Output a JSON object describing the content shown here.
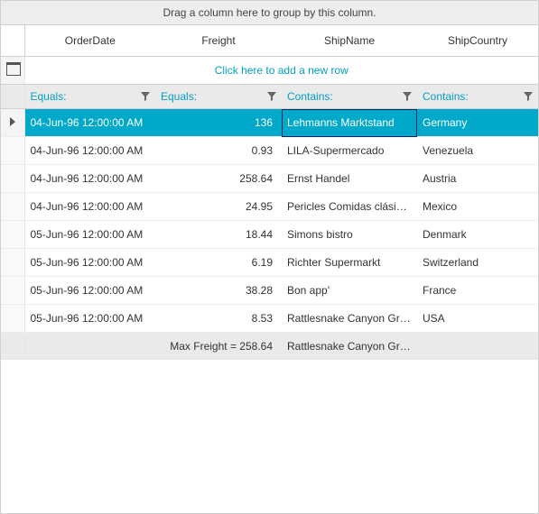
{
  "groupBar": {
    "hint": "Drag a column here to group by this column."
  },
  "columns": {
    "orderDate": "OrderDate",
    "freight": "Freight",
    "shipName": "ShipName",
    "shipCountry": "ShipCountry"
  },
  "addRow": {
    "label": "Click here to add a new row"
  },
  "filters": {
    "orderDate": "Equals:",
    "freight": "Equals:",
    "shipName": "Contains:",
    "shipCountry": "Contains:"
  },
  "rows": [
    {
      "orderDate": "04-Jun-96 12:00:00 AM",
      "freight": "136",
      "shipName": "Lehmanns Marktstand",
      "shipCountry": "Germany",
      "selected": true
    },
    {
      "orderDate": "04-Jun-96 12:00:00 AM",
      "freight": "0.93",
      "shipName": "LILA-Supermercado",
      "shipCountry": "Venezuela"
    },
    {
      "orderDate": "04-Jun-96 12:00:00 AM",
      "freight": "258.64",
      "shipName": "Ernst Handel",
      "shipCountry": "Austria"
    },
    {
      "orderDate": "04-Jun-96 12:00:00 AM",
      "freight": "24.95",
      "shipName": "Pericles Comidas clásicas",
      "shipCountry": "Mexico"
    },
    {
      "orderDate": "05-Jun-96 12:00:00 AM",
      "freight": "18.44",
      "shipName": "Simons bistro",
      "shipCountry": "Denmark"
    },
    {
      "orderDate": "05-Jun-96 12:00:00 AM",
      "freight": "6.19",
      "shipName": "Richter Supermarkt",
      "shipCountry": "Switzerland"
    },
    {
      "orderDate": "05-Jun-96 12:00:00 AM",
      "freight": "38.28",
      "shipName": "Bon app'",
      "shipCountry": "France"
    },
    {
      "orderDate": "05-Jun-96 12:00:00 AM",
      "freight": "8.53",
      "shipName": "Rattlesnake Canyon Groc...",
      "shipCountry": "USA"
    }
  ],
  "summary": {
    "freight": "Max Freight = 258.64",
    "shipName": "Rattlesnake Canyon Groc..."
  }
}
